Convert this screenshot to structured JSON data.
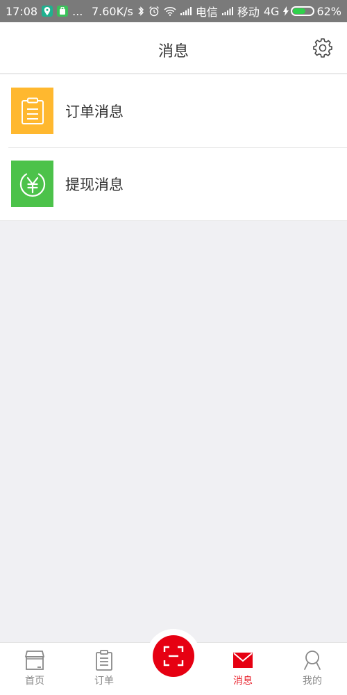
{
  "status_bar": {
    "time": "17:08",
    "dots": "...",
    "speed": "7.60K/s",
    "carrier1": "电信",
    "carrier2": "移动",
    "network": "4G",
    "battery": "62%",
    "battery_level": 0.62
  },
  "header": {
    "title": "消息"
  },
  "messages": {
    "items": [
      {
        "label": "订单消息",
        "icon": "clipboard-icon",
        "color": "#ffb82f"
      },
      {
        "label": "提现消息",
        "icon": "yuan-coin-icon",
        "color": "#4cc24a"
      }
    ]
  },
  "nav": {
    "home": "首页",
    "orders": "订单",
    "messages": "消息",
    "mine": "我的",
    "scan_icon": "scan-icon",
    "accent_color": "#e60012"
  }
}
